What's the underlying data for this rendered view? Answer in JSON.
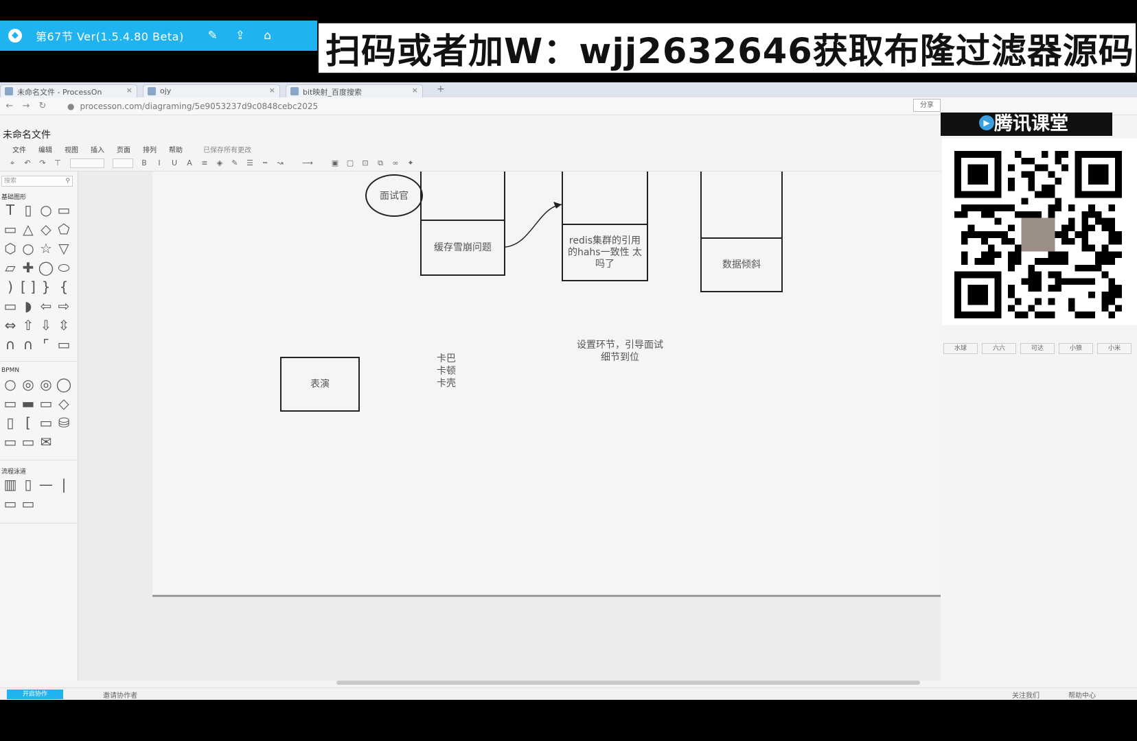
{
  "recorder": {
    "title": "第67节 Ver(1.5.4.80 Beta)",
    "banner": "扫码或者加W：wjj2632646获取布隆过滤器源码"
  },
  "browser": {
    "tabs": [
      {
        "label": "未命名文件 - ProcessOn"
      },
      {
        "label": "ojy"
      },
      {
        "label": "bit映射_百度搜索"
      }
    ],
    "url": "processon.com/diagraming/5e9053237d9c0848cebc2025",
    "share_label": "分享"
  },
  "app": {
    "doc_title": "未命名文件",
    "menu": [
      "文件",
      "编辑",
      "视图",
      "插入",
      "页面",
      "排列",
      "帮助"
    ],
    "saved_status": "已保存所有更改"
  },
  "panel": {
    "search_placeholder": "搜索",
    "categories": [
      "基础图形",
      "BPMN",
      "流程泳道"
    ]
  },
  "diagram": {
    "circle_label": "面试官",
    "performance_label": "表演",
    "col1_label": "缓存雪崩问题",
    "col2_label": "redis集群的引用的hahs一致性 太吗了",
    "col3_label": "数据倾斜",
    "stutter_lines": [
      "卡巴",
      "卡顿",
      "卡壳"
    ],
    "setup_lines": [
      "设置环节，引导面试",
      "细节到位"
    ]
  },
  "status": {
    "left_button": "开启协作",
    "collab": "邀请协作者",
    "follow": "关注我们",
    "help": "帮助中心"
  },
  "overlay": {
    "brand": "腾讯课堂",
    "qr_labels": [
      "水球",
      "六六",
      "可达",
      "小狼",
      "小米"
    ]
  }
}
